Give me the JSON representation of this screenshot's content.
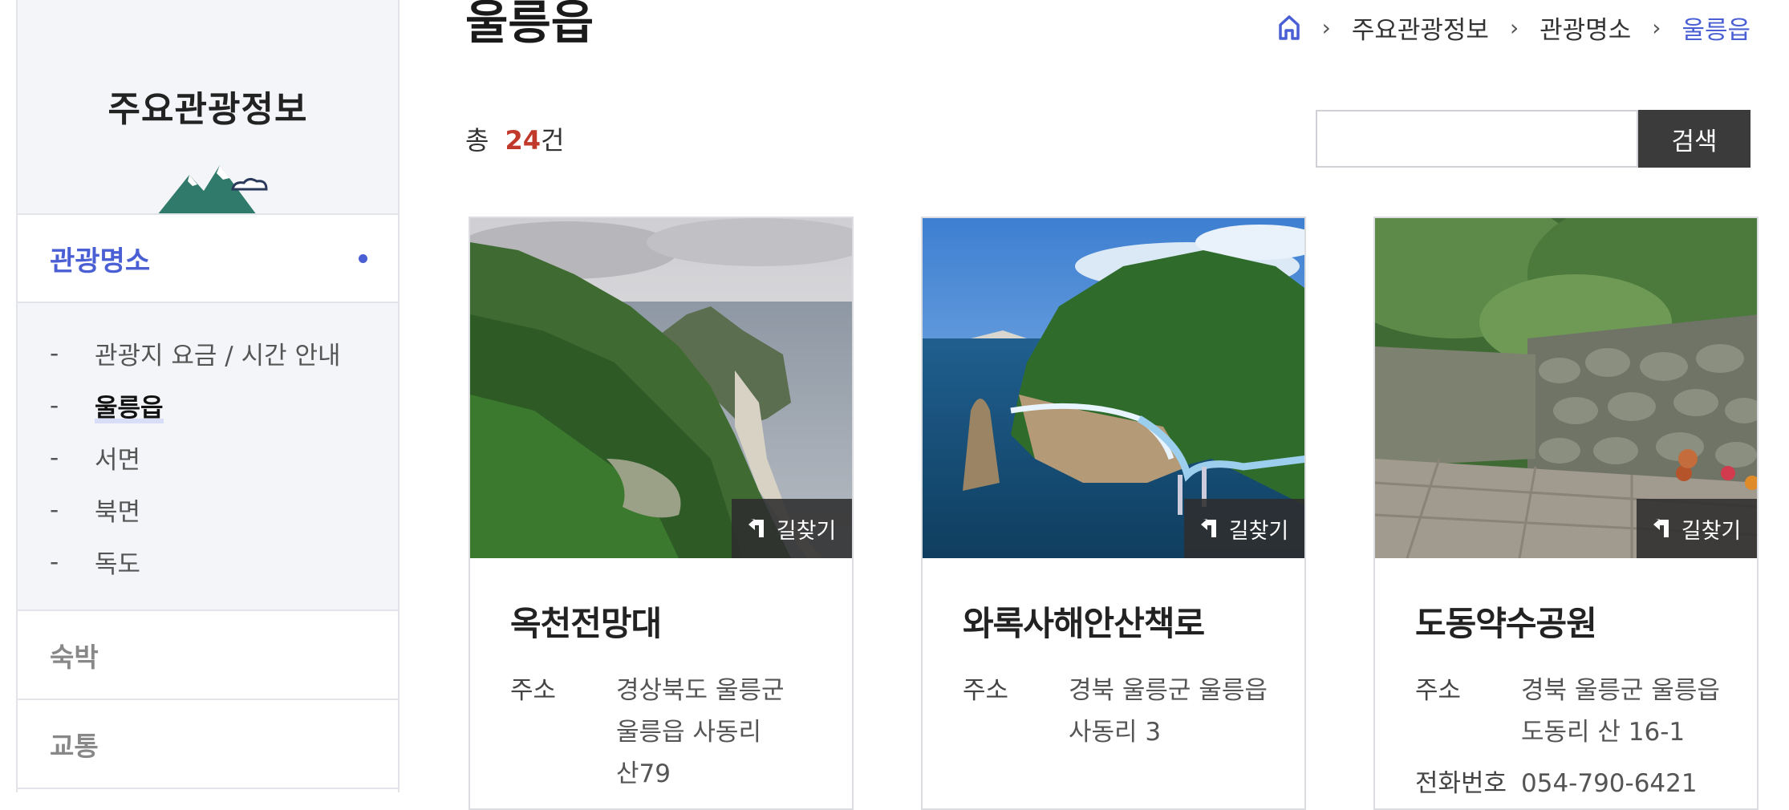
{
  "sidebar": {
    "title": "주요관광정보",
    "active_menu": "관광명소",
    "sub_items": [
      {
        "label": "관광지 요금 / 시간 안내"
      },
      {
        "label": "울릉읍"
      },
      {
        "label": "서면"
      },
      {
        "label": "북면"
      },
      {
        "label": "독도"
      }
    ],
    "other_menus": [
      "숙박",
      "교통"
    ],
    "accent_color": "#4a5fd4"
  },
  "page": {
    "title": "울릉읍",
    "breadcrumb": [
      "주요관광정보",
      "관광명소",
      "울릉읍"
    ]
  },
  "list": {
    "total_prefix": "총",
    "total_count": "24",
    "total_suffix": "건",
    "search_value": "",
    "search_button": "검색"
  },
  "cards": [
    {
      "name": "옥천전망대",
      "route_label": "길찾기",
      "address_key": "주소",
      "address_lines": [
        "경상북도 울릉군",
        "울릉읍 사동리",
        "산79"
      ]
    },
    {
      "name": "와록사해안산책로",
      "route_label": "길찾기",
      "address_key": "주소",
      "address_lines": [
        "경북 울릉군 울릉읍",
        "사동리 3"
      ]
    },
    {
      "name": "도동약수공원",
      "route_label": "길찾기",
      "address_key": "주소",
      "address_lines": [
        "경북 울릉군 울릉읍",
        "도동리 산 16-1"
      ],
      "phone_key": "전화번호",
      "phone": "054-790-6421"
    }
  ]
}
